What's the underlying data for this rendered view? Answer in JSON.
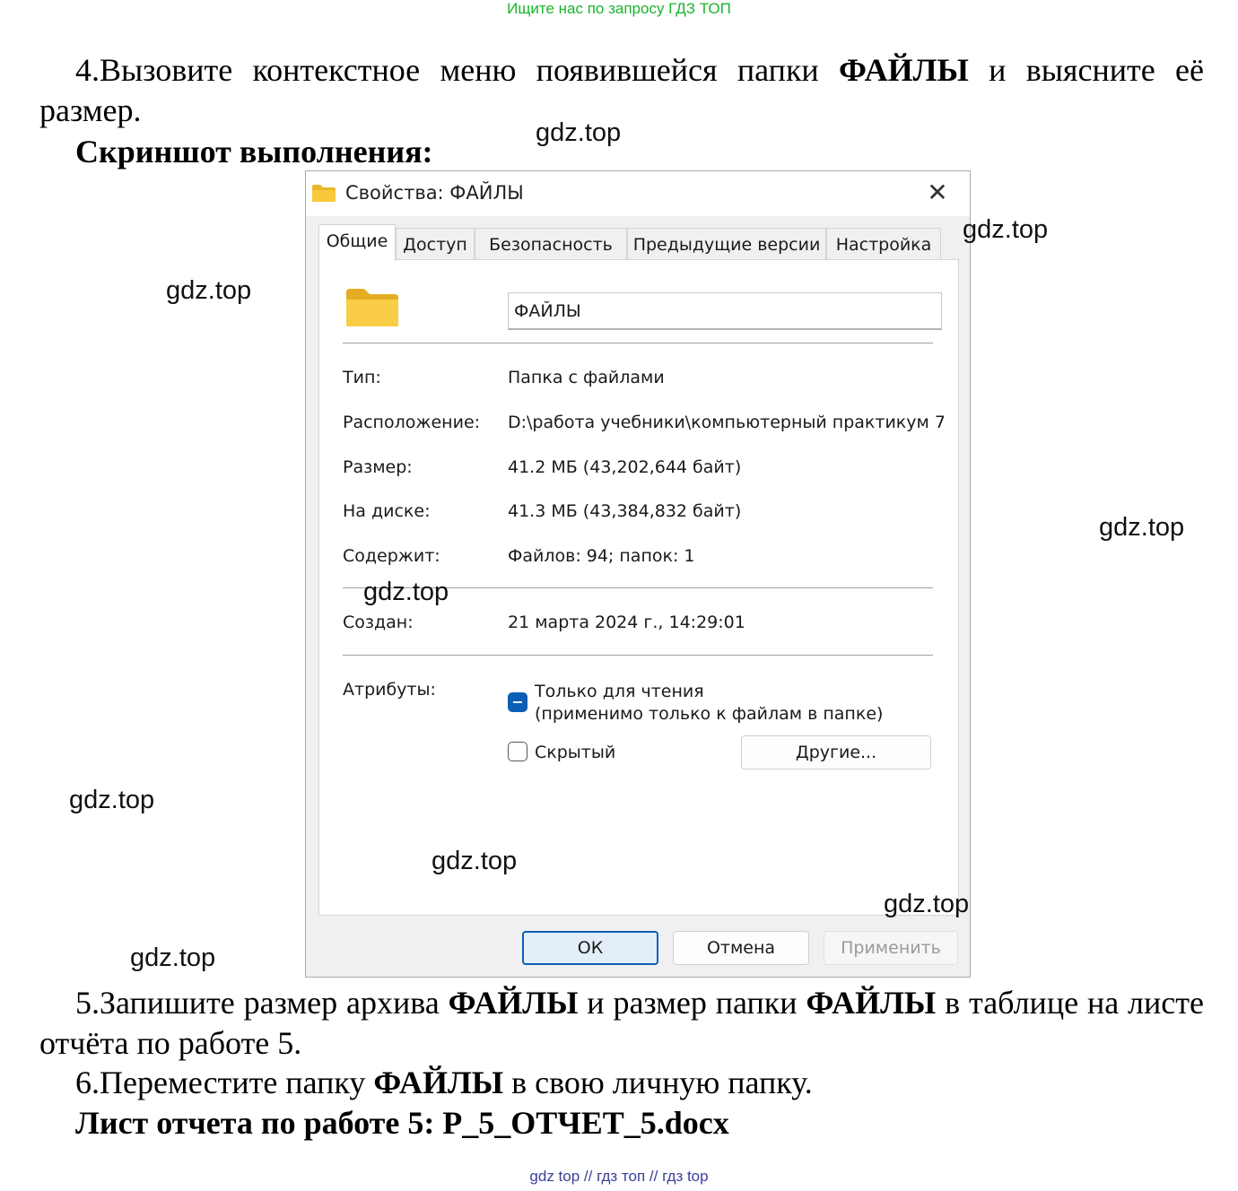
{
  "banner": "Ищите нас по запросу ГДЗ ТОП",
  "doc": {
    "step4_prefix": "4.Вызовите контекстное меню появившейся папки ",
    "step4_bold": "ФАЙЛЫ",
    "step4_suffix": " и выясните её размер.",
    "screenshot_heading": "Скриншот выполнения:",
    "step5_prefix": "5.Запишите размер архива ",
    "step5_bold1": "ФАЙЛЫ",
    "step5_middle": " и размер папки ",
    "step5_bold2": "ФАЙЛЫ",
    "step5_suffix": " в таблице на листе отчёта по работе 5.",
    "step6_prefix": "6.Переместите папку ",
    "step6_bold": "ФАЙЛЫ",
    "step6_suffix": " в свою личную папку.",
    "report": "Лист отчета по работе 5: P_5_ОТЧЕТ_5.docx"
  },
  "watermark": "gdz.top",
  "footer": "gdz top  //  гдз топ  //  гдз top",
  "dialog": {
    "title": "Свойства: ФАЙЛЫ",
    "close_glyph": "✕",
    "tabs": [
      "Общие",
      "Доступ",
      "Безопасность",
      "Предыдущие версии",
      "Настройка"
    ],
    "name_value": "ФАЙЛЫ",
    "props": {
      "type_label": "Тип:",
      "type_value": "Папка с файлами",
      "location_label": "Расположение:",
      "location_value": "D:\\работа учебники\\компьютерный практикум 7",
      "size_label": "Размер:",
      "size_value": "41.2 МБ (43,202,644 байт)",
      "disk_label": "На диске:",
      "disk_value": "41.3 МБ (43,384,832 байт)",
      "contains_label": "Содержит:",
      "contains_value": "Файлов: 94; папок: 1",
      "created_label": "Создан:",
      "created_value": "21 марта 2024 г., 14:29:01"
    },
    "attributes": {
      "label": "Атрибуты:",
      "readonly_line1": "Только для чтения",
      "readonly_line2": "(применимо только к файлам в папке)",
      "readonly_state": "indeterminate",
      "hidden_label": "Скрытый",
      "hidden_checked": false,
      "advanced_button": "Другие..."
    },
    "buttons": {
      "ok": "ОК",
      "cancel": "Отмена",
      "apply": "Применить"
    },
    "colors": {
      "accent": "#0a5fb4",
      "folder": "#f8c93c"
    }
  }
}
